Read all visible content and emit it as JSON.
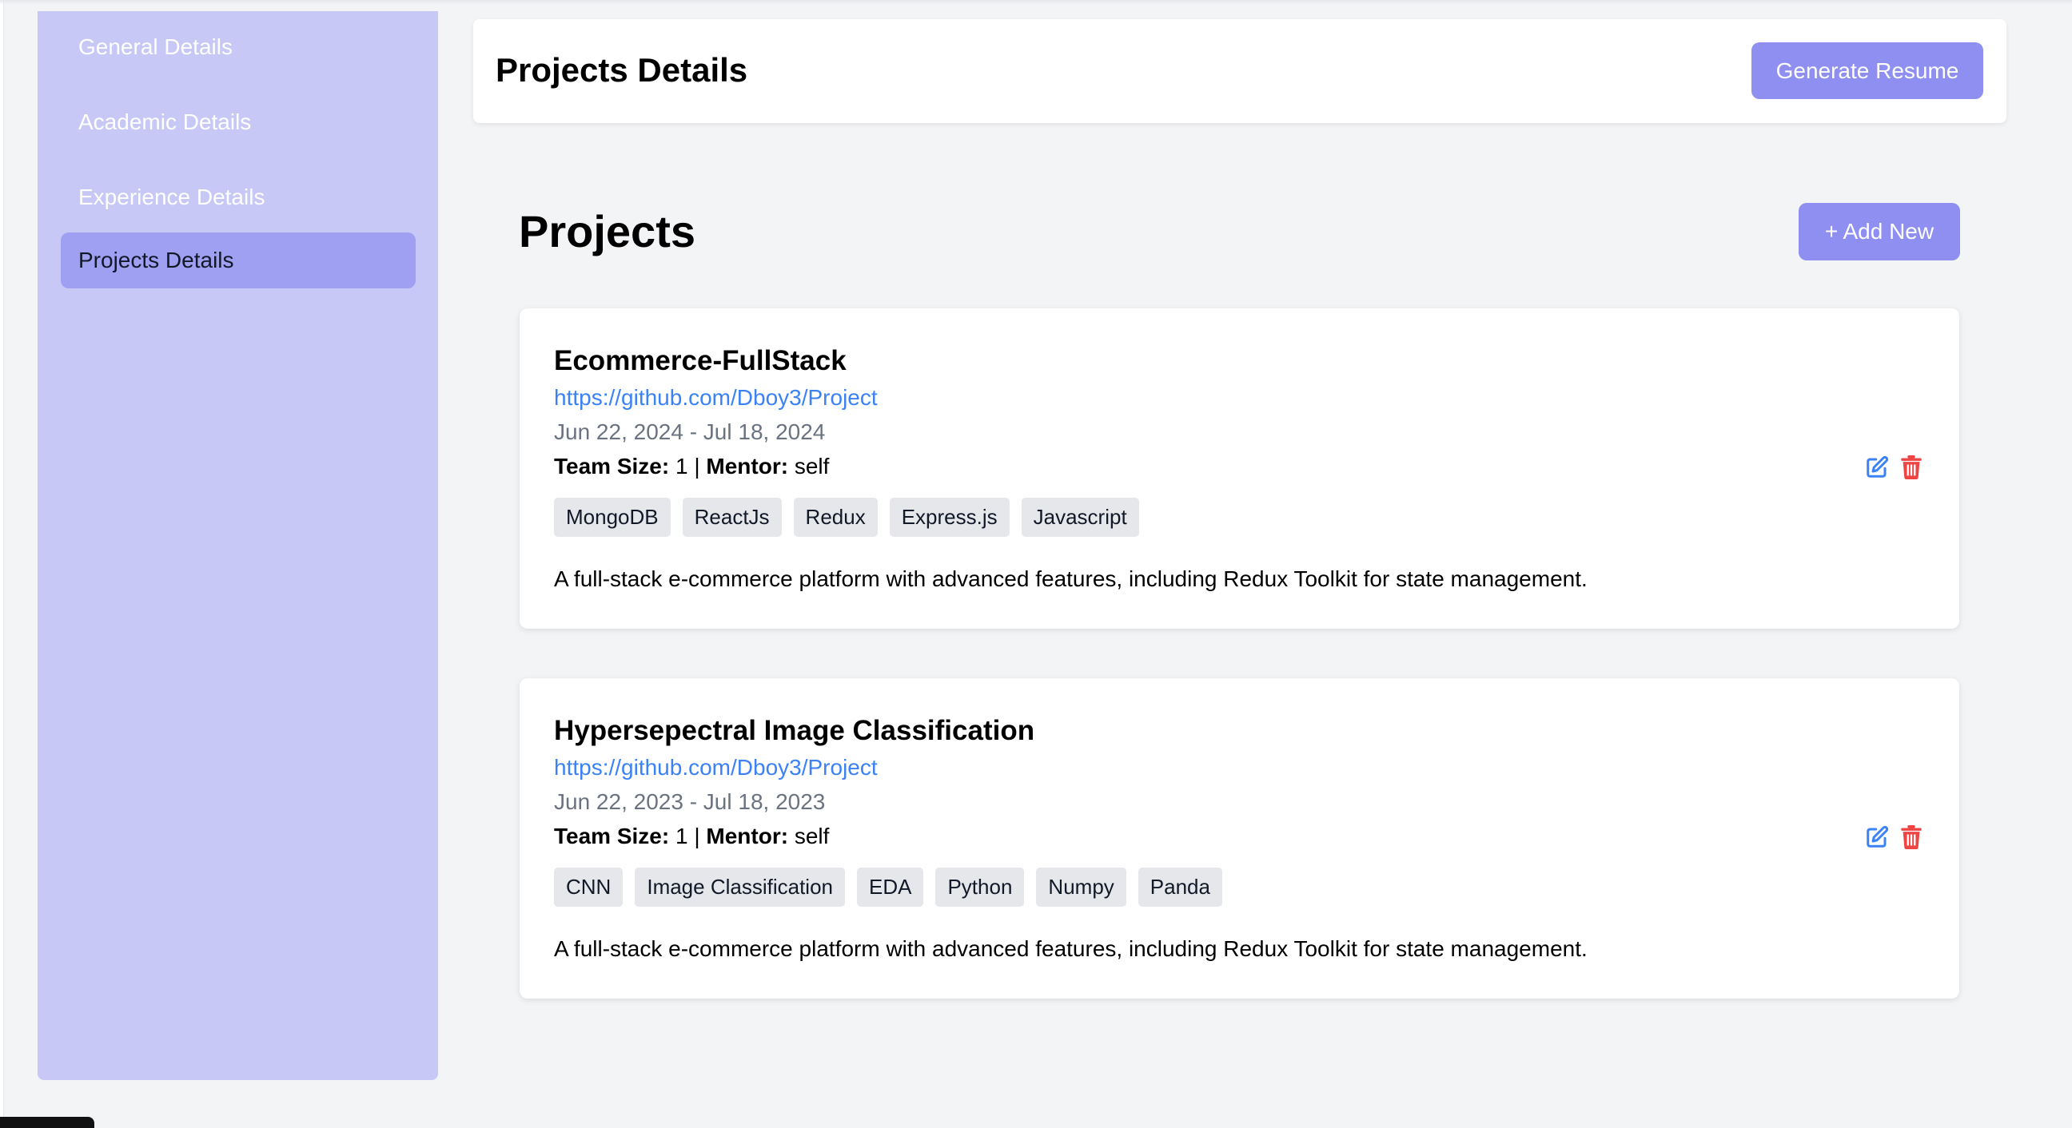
{
  "sidebar": {
    "items": [
      {
        "label": "General Details",
        "active": false
      },
      {
        "label": "Academic Details",
        "active": false
      },
      {
        "label": "Experience Details",
        "active": false
      },
      {
        "label": "Projects Details",
        "active": true
      }
    ]
  },
  "header": {
    "title": "Projects Details",
    "generate_label": "Generate Resume"
  },
  "section": {
    "title": "Projects",
    "add_label": "+ Add New"
  },
  "labels": {
    "team_size": "Team Size:",
    "mentor": "Mentor:",
    "separator": "|"
  },
  "projects": [
    {
      "title": "Ecommerce-FullStack",
      "link": "https://github.com/Dboy3/Project",
      "dates": "Jun 22, 2024 - Jul 18, 2024",
      "team_size": "1",
      "mentor": "self",
      "tags": [
        "MongoDB",
        "ReactJs",
        "Redux",
        "Express.js",
        "Javascript"
      ],
      "description": "A full-stack e-commerce platform with advanced features, including Redux Toolkit for state management."
    },
    {
      "title": "Hypersepectral Image Classification",
      "link": "https://github.com/Dboy3/Project",
      "dates": "Jun 22, 2023 - Jul 18, 2023",
      "team_size": "1",
      "mentor": "self",
      "tags": [
        "CNN",
        "Image Classification",
        "EDA",
        "Python",
        "Numpy",
        "Panda"
      ],
      "description": "A full-stack e-commerce platform with advanced features, including Redux Toolkit for state management."
    }
  ],
  "colors": {
    "sidebar_bg": "#c7c8f6",
    "sidebar_active": "#9fa0f2",
    "primary_button": "#8e8ff0",
    "link": "#3b82f6",
    "edit_icon": "#3b82f6",
    "delete_icon": "#ef4444"
  },
  "icons": {
    "edit": "edit-icon",
    "delete": "trash-icon"
  }
}
